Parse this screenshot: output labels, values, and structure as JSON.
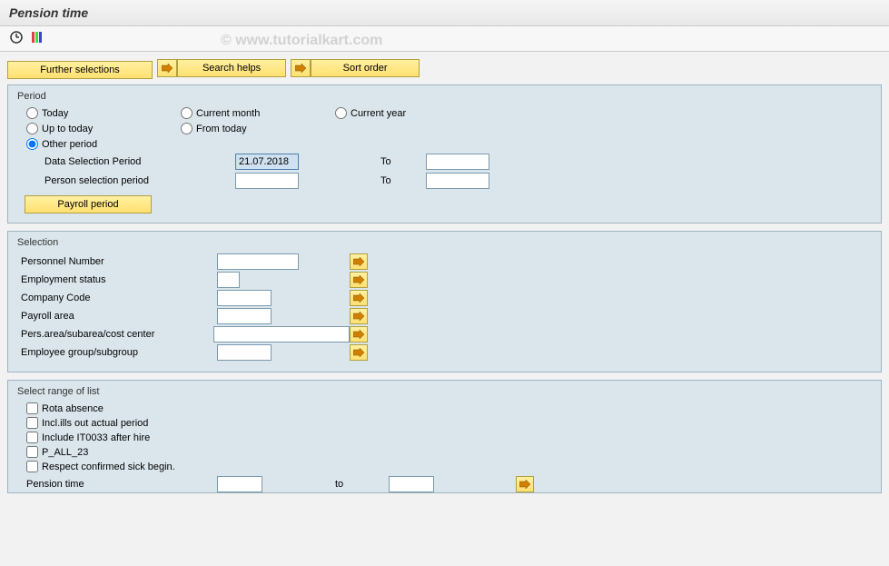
{
  "title": "Pension time",
  "watermark": "© www.tutorialkart.com",
  "buttons": {
    "further_selections": "Further selections",
    "search_helps": "Search helps",
    "sort_order": "Sort order",
    "payroll_period": "Payroll period"
  },
  "period": {
    "title": "Period",
    "today": "Today",
    "current_month": "Current month",
    "current_year": "Current year",
    "up_to_today": "Up to today",
    "from_today": "From today",
    "other_period": "Other period",
    "data_selection_period": "Data Selection Period",
    "data_selection_value": "21.07.2018",
    "person_selection_period": "Person selection period",
    "to": "To"
  },
  "selection": {
    "title": "Selection",
    "personnel_number": "Personnel Number",
    "employment_status": "Employment status",
    "company_code": "Company Code",
    "payroll_area": "Payroll area",
    "pers_area": "Pers.area/subarea/cost center",
    "employee_group": "Employee group/subgroup"
  },
  "range": {
    "title": "Select range of list",
    "rota_absence": "Rota absence",
    "incl_ills": "Incl.ills out actual period",
    "include_it0033": "Include IT0033 after hire",
    "p_all_23": "P_ALL_23",
    "respect_confirmed": "Respect confirmed sick begin.",
    "pension_time": "Pension time",
    "to": "to"
  }
}
